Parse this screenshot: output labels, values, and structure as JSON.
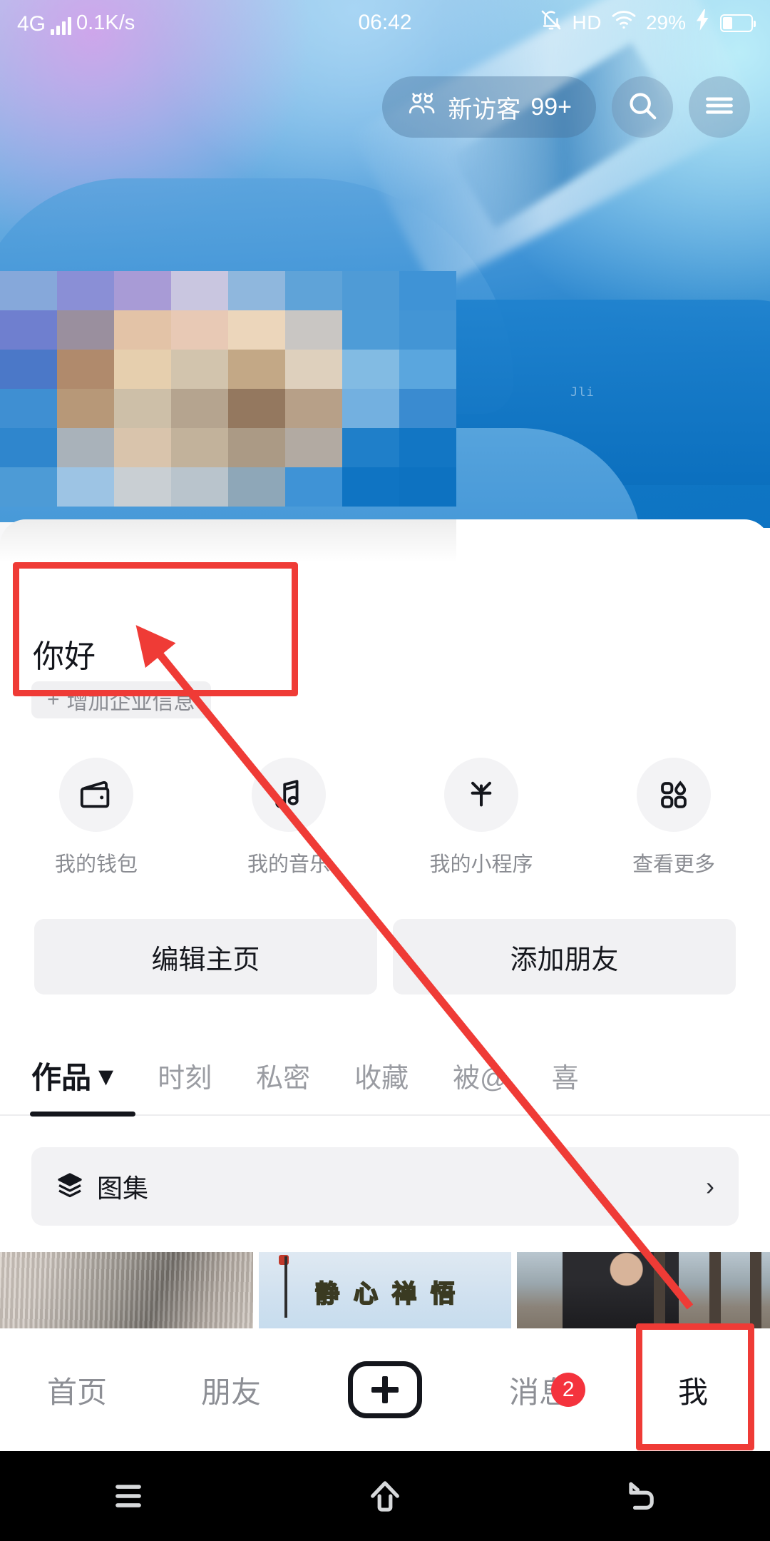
{
  "statusbar": {
    "network": "4G",
    "speed": "0.1K/s",
    "time": "06:42",
    "hd": "HD",
    "battery_percent": "29%",
    "icons": [
      "signal-bars-icon",
      "mute-bell-icon",
      "hd-icon",
      "wifi-icon",
      "charging-bolt-icon",
      "battery-icon"
    ]
  },
  "header": {
    "visitor_label": "新访客",
    "visitor_count": "99+",
    "visitor_icon": "visitors-icon",
    "search_icon": "search-icon",
    "menu_icon": "hamburger-menu-icon"
  },
  "profile": {
    "nickname": "你好",
    "business_chip": "增加企业信息",
    "business_chip_prefix": "+"
  },
  "quick_actions": [
    {
      "label": "我的钱包",
      "icon": "wallet-icon"
    },
    {
      "label": "我的音乐",
      "icon": "music-note-icon"
    },
    {
      "label": "我的小程序",
      "icon": "mini-program-icon"
    },
    {
      "label": "查看更多",
      "icon": "grid-more-icon"
    }
  ],
  "primary_buttons": [
    {
      "label": "编辑主页"
    },
    {
      "label": "添加朋友"
    }
  ],
  "tabs": [
    {
      "label": "作品",
      "active": true,
      "caret": "▾"
    },
    {
      "label": "时刻",
      "active": false
    },
    {
      "label": "私密",
      "active": false
    },
    {
      "label": "收藏",
      "active": false
    },
    {
      "label": "被@",
      "active": false
    },
    {
      "label": "喜",
      "active": false
    }
  ],
  "album_row": {
    "label": "图集",
    "icon": "layers-stack-icon",
    "chevron": "›"
  },
  "cover": {
    "watermark": "Jli"
  },
  "bottom_nav": [
    {
      "label": "首页",
      "active": false
    },
    {
      "label": "朋友",
      "active": false
    },
    {
      "label": "",
      "active": false,
      "icon": "plus-create-icon"
    },
    {
      "label": "消息",
      "active": false,
      "badge": "2"
    },
    {
      "label": "我",
      "active": true
    }
  ],
  "android_nav": [
    {
      "icon": "recents-menu-icon"
    },
    {
      "icon": "home-icon"
    },
    {
      "icon": "back-icon"
    }
  ],
  "annotations": {
    "accent_color": "#ef3b36",
    "box_nickname_target": "你好",
    "box_tab_target": "我",
    "arrow": "points from 我 tab up-left to 你好 nickname"
  },
  "mosaic": {
    "avatar_colors": [
      "#86a8da",
      "#8a8fd6",
      "#a89bd6",
      "#c9c6e0",
      "#8fb7dd",
      "#5fa3d8",
      "#4f9bd6",
      "#3f93d6",
      "#6f7fcf",
      "#9a8f9e",
      "#e3c3a7",
      "#e8c9b5",
      "#ecd6bb",
      "#c9c6c3",
      "#4e9cd7",
      "#4395d5",
      "#4b78c8",
      "#b08a6c",
      "#e6cfae",
      "#d2c4ad",
      "#c3a886",
      "#ded0bd",
      "#82bbe3",
      "#5aa6de",
      "#3f8fd2",
      "#b79878",
      "#cdbfa8",
      "#b5a48f",
      "#94785f",
      "#b7a088",
      "#73b0e0",
      "#3a8bd0",
      "#2f86cd",
      "#a9b2ba",
      "#d9c4ac",
      "#c2b29b",
      "#ab9a85",
      "#b2aaa2",
      "#1f7fc9",
      "#1276c4",
      "#4d9bd6",
      "#9dc4e4",
      "#c9cfd3",
      "#b9c4cc",
      "#8ea7b8",
      "#3f93d6",
      "#0f74c3",
      "#0d72c1"
    ],
    "name_colors": [
      "#f7f7f8",
      "#e6e6e8",
      "#ededef",
      "#f5f5f6",
      "#f3f3f4",
      "#eeeeef",
      "#e2e2e4",
      "#efeff0",
      "#f6f6f7",
      "#fbfbfb",
      "#f0f0f1",
      "#dedee0",
      "#e9e9eb",
      "#f2f2f3",
      "#efeff0",
      "#e8e8ea",
      "#cfcfd1",
      "#e4e4e6",
      "#f1f1f2",
      "#fafafa",
      "#ededee",
      "#d6d6d8",
      "#e3e3e5",
      "#eeeeef",
      "#ececed",
      "#e1e1e3",
      "#c3c3c5",
      "#dcdcde",
      "#efeff0",
      "#f8f8f9"
    ]
  }
}
